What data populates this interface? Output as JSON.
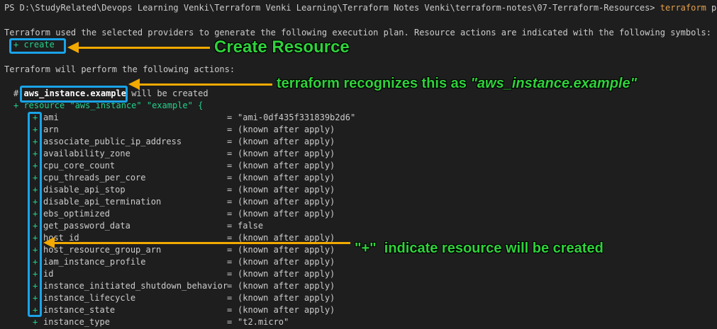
{
  "prompt": {
    "prefix": "PS D:\\StudyRelated\\Devops Learning Venki\\Terraform Venki Learning\\Terraform Notes Venki\\terraform-notes\\07-Terraform-Resources>",
    "command": "terraform",
    "argument": "plan"
  },
  "intro": "Terraform used the selected providers to generate the following execution plan. Resource actions are indicated with the following symbols:",
  "symbol_create": "+ create",
  "actions_heading": "Terraform will perform the following actions:",
  "resource_comment": {
    "hash": "#",
    "address": "aws_instance.example",
    "suffix": "will be created"
  },
  "resource_header": "+ resource \"aws_instance\" \"example\" {",
  "attributes": [
    {
      "name": "ami",
      "value": "\"ami-0df435f331839b2d6\""
    },
    {
      "name": "arn",
      "value": "(known after apply)"
    },
    {
      "name": "associate_public_ip_address",
      "value": "(known after apply)"
    },
    {
      "name": "availability_zone",
      "value": "(known after apply)"
    },
    {
      "name": "cpu_core_count",
      "value": "(known after apply)"
    },
    {
      "name": "cpu_threads_per_core",
      "value": "(known after apply)"
    },
    {
      "name": "disable_api_stop",
      "value": "(known after apply)"
    },
    {
      "name": "disable_api_termination",
      "value": "(known after apply)"
    },
    {
      "name": "ebs_optimized",
      "value": "(known after apply)"
    },
    {
      "name": "get_password_data",
      "value": "false"
    },
    {
      "name": "host_id",
      "value": "(known after apply)"
    },
    {
      "name": "host_resource_group_arn",
      "value": "(known after apply)"
    },
    {
      "name": "iam_instance_profile",
      "value": "(known after apply)"
    },
    {
      "name": "id",
      "value": "(known after apply)"
    },
    {
      "name": "instance_initiated_shutdown_behavior",
      "value": "(known after apply)"
    },
    {
      "name": "instance_lifecycle",
      "value": "(known after apply)"
    },
    {
      "name": "instance_state",
      "value": "(known after apply)"
    },
    {
      "name": "instance_type",
      "value": "\"t2.micro\""
    }
  ],
  "plus": "+",
  "equals": "=",
  "annotations": {
    "create_resource": "Create Resource",
    "recognizes_prefix": "terraform recognizes this as",
    "recognizes_quoted": "\"aws_instance.example\"",
    "plus_indicates_quoted": "\"+\"",
    "plus_indicates_text": "indicate resource will be created"
  },
  "colors": {
    "background": "#1e1e1e",
    "text": "#cccccc",
    "plus_green": "#23d18b",
    "command_orange": "#e5a04b",
    "highlight_box": "#1aa3e8",
    "arrow": "#f2a900",
    "annotation_green": "#2fd23b"
  }
}
